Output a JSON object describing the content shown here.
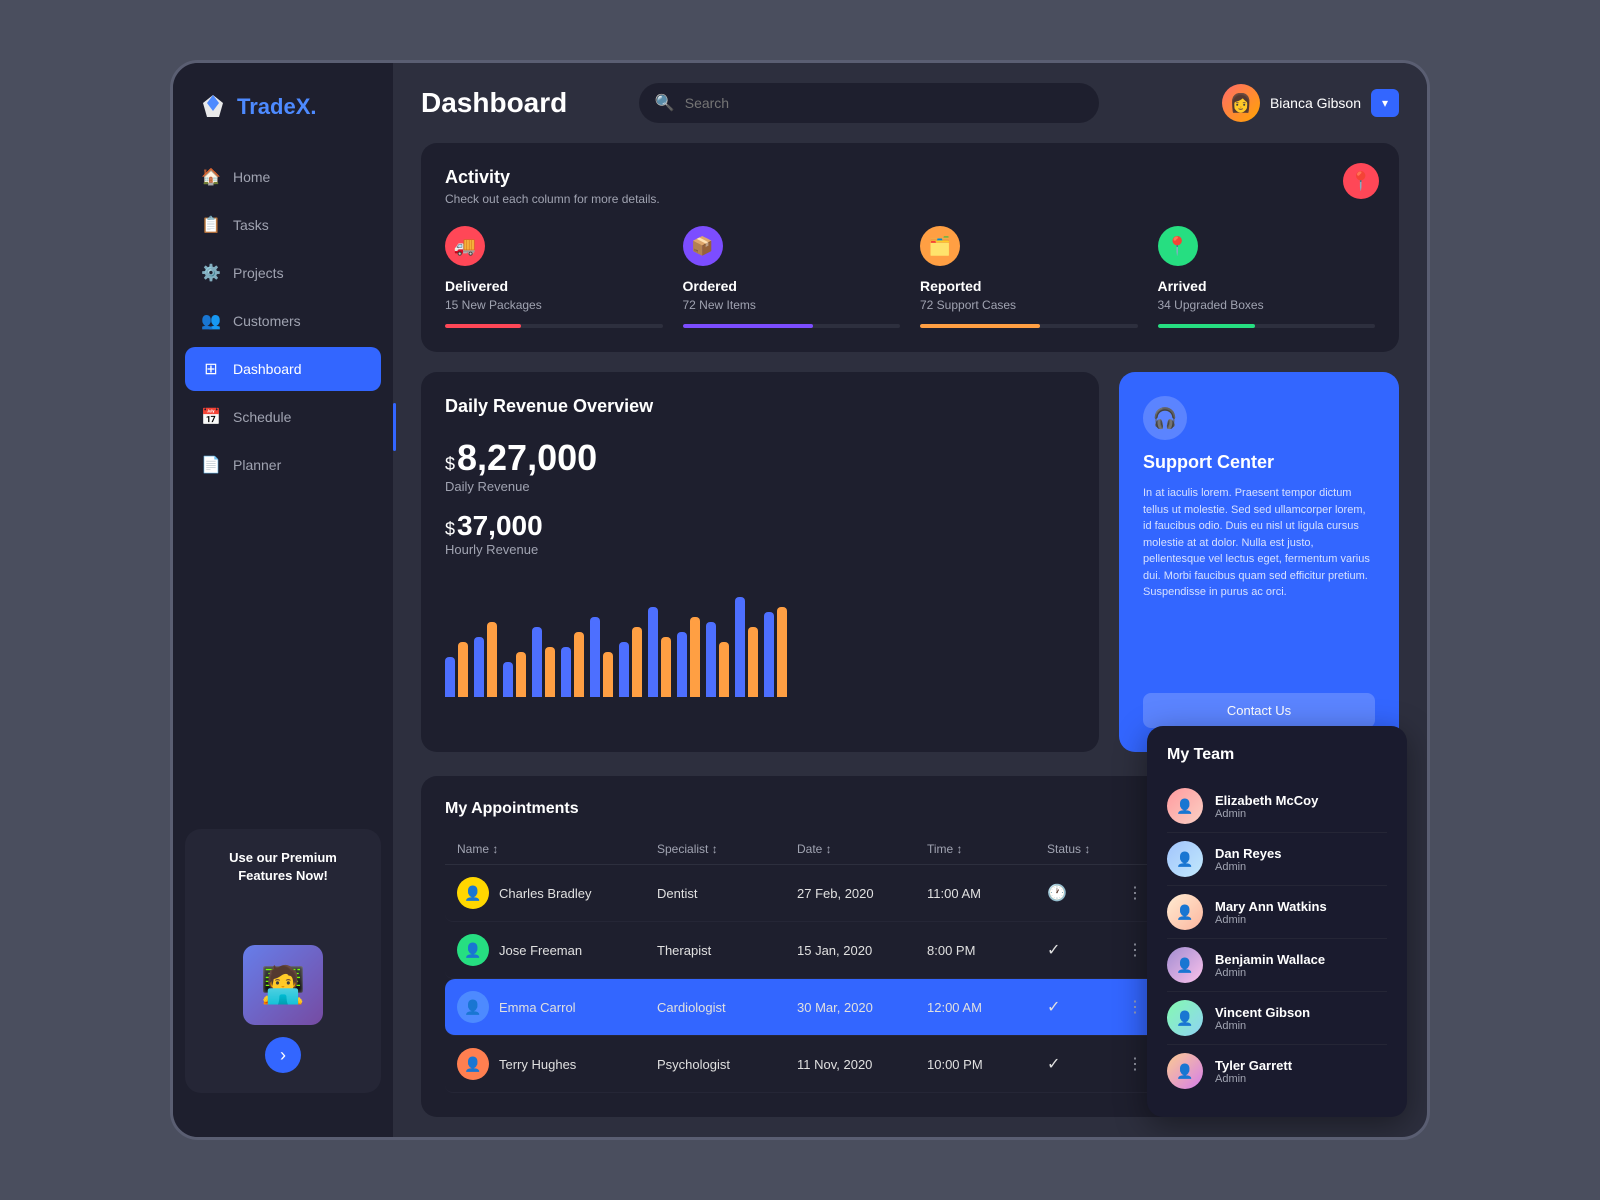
{
  "app": {
    "logo_text": "Trade",
    "logo_accent": "X.",
    "page_title": "Dashboard"
  },
  "sidebar": {
    "nav_items": [
      {
        "id": "home",
        "label": "Home",
        "icon": "🏠",
        "active": false
      },
      {
        "id": "tasks",
        "label": "Tasks",
        "icon": "📋",
        "active": false
      },
      {
        "id": "projects",
        "label": "Projects",
        "icon": "⚙️",
        "active": false
      },
      {
        "id": "customers",
        "label": "Customers",
        "icon": "👥",
        "active": false
      },
      {
        "id": "dashboard",
        "label": "Dashboard",
        "icon": "⊞",
        "active": true
      },
      {
        "id": "schedule",
        "label": "Schedule",
        "icon": "📅",
        "active": false
      },
      {
        "id": "planner",
        "label": "Planner",
        "icon": "📄",
        "active": false
      }
    ],
    "premium": {
      "title": "Use our Premium Features Now!",
      "button_icon": "›"
    }
  },
  "header": {
    "search_placeholder": "Search",
    "user": {
      "name": "Bianca Gibson",
      "dropdown_icon": "▾"
    }
  },
  "activity": {
    "title": "Activity",
    "subtitle": "Check out each column for more details.",
    "columns": [
      {
        "id": "delivered",
        "icon": "🚚",
        "icon_class": "icon-red",
        "title": "Delivered",
        "subtitle": "15 New Packages",
        "fill_class": "fill-red"
      },
      {
        "id": "ordered",
        "icon": "📦",
        "icon_class": "icon-purple",
        "title": "Ordered",
        "subtitle": "72 New Items",
        "fill_class": "fill-purple"
      },
      {
        "id": "reported",
        "icon": "🗂️",
        "icon_class": "icon-orange",
        "title": "Reported",
        "subtitle": "72 Support Cases",
        "fill_class": "fill-orange"
      },
      {
        "id": "arrived",
        "icon": "📍",
        "icon_class": "icon-green",
        "title": "Arrived",
        "subtitle": "34 Upgraded Boxes",
        "fill_class": "fill-green"
      }
    ]
  },
  "revenue": {
    "title": "Daily Revenue Overview",
    "daily_prefix": "$",
    "daily_amount": "8,27,000",
    "daily_label": "Daily Revenue",
    "hourly_prefix": "$",
    "hourly_amount": "37,000",
    "hourly_label": "Hourly Revenue",
    "chart_bars": [
      {
        "blue": 40,
        "orange": 55
      },
      {
        "blue": 60,
        "orange": 75
      },
      {
        "blue": 35,
        "orange": 45
      },
      {
        "blue": 70,
        "orange": 50
      },
      {
        "blue": 50,
        "orange": 65
      },
      {
        "blue": 80,
        "orange": 45
      },
      {
        "blue": 55,
        "orange": 70
      },
      {
        "blue": 90,
        "orange": 60
      },
      {
        "blue": 65,
        "orange": 80
      },
      {
        "blue": 75,
        "orange": 55
      },
      {
        "blue": 100,
        "orange": 70
      },
      {
        "blue": 85,
        "orange": 90
      }
    ]
  },
  "support": {
    "icon": "🎧",
    "title": "Support Center",
    "description": "In at iaculis lorem. Praesent tempor dictum tellus ut molestie. Sed sed ullamcorper lorem, id faucibus odio. Duis eu nisl ut ligula cursus molestie at at dolor. Nulla est justo, pellentesque vel lectus eget, fermentum varius dui. Morbi faucibus quam sed efficitur pretium. Suspendisse in purus ac orci.",
    "contact_label": "Contact Us"
  },
  "appointments": {
    "title": "My Appointments",
    "headers": [
      "Name ↕",
      "Specialist ↕",
      "Date ↕",
      "Time ↕",
      "Status ↕",
      ""
    ],
    "rows": [
      {
        "id": 1,
        "name": "Charles Bradley",
        "specialist": "Dentist",
        "date": "27 Feb, 2020",
        "time": "11:00 AM",
        "status": "pending",
        "status_icon": "🕐",
        "active": false,
        "av_class": "av-yellow"
      },
      {
        "id": 2,
        "name": "Jose Freeman",
        "specialist": "Therapist",
        "date": "15 Jan, 2020",
        "time": "8:00 PM",
        "status": "done",
        "status_icon": "✓",
        "active": false,
        "av_class": "av-teal"
      },
      {
        "id": 3,
        "name": "Emma Carrol",
        "specialist": "Cardiologist",
        "date": "30 Mar, 2020",
        "time": "12:00 AM",
        "status": "done",
        "status_icon": "✓",
        "active": true,
        "av_class": "av-blue"
      },
      {
        "id": 4,
        "name": "Terry Hughes",
        "specialist": "Psychologist",
        "date": "11 Nov, 2020",
        "time": "10:00 PM",
        "status": "done",
        "status_icon": "✓",
        "active": false,
        "av_class": "av-orange"
      }
    ]
  },
  "team": {
    "title": "My Team",
    "members": [
      {
        "id": 1,
        "name": "Elizabeth McCoy",
        "role": "Admin",
        "av_class": "ta-1"
      },
      {
        "id": 2,
        "name": "Dan Reyes",
        "role": "Admin",
        "av_class": "ta-2"
      },
      {
        "id": 3,
        "name": "Mary Ann Watkins",
        "role": "Admin",
        "av_class": "ta-3"
      },
      {
        "id": 4,
        "name": "Benjamin Wallace",
        "role": "Admin",
        "av_class": "ta-4"
      },
      {
        "id": 5,
        "name": "Vincent Gibson",
        "role": "Admin",
        "av_class": "ta-5"
      },
      {
        "id": 6,
        "name": "Tyler Garrett",
        "role": "Admin",
        "av_class": "ta-6"
      }
    ]
  }
}
